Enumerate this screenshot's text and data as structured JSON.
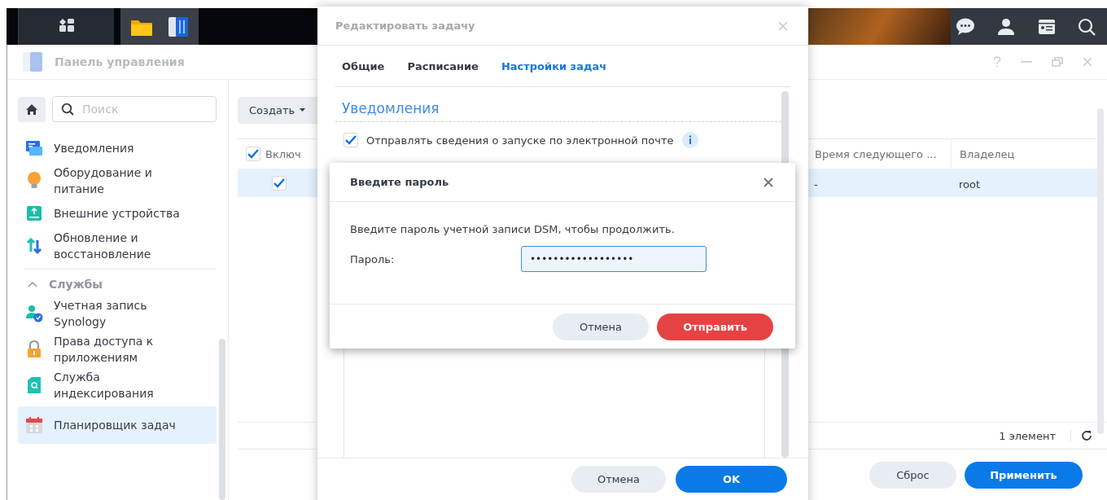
{
  "control_panel": {
    "title": "Панель управления",
    "search": {
      "placeholder": "Поиск"
    },
    "sidebar": {
      "items": [
        {
          "label": "Уведомления",
          "selected": false
        },
        {
          "label": "Оборудование и питание",
          "selected": false
        },
        {
          "label": "Внешние устройства",
          "selected": false
        },
        {
          "label": "Обновление и восстановление",
          "selected": false
        }
      ],
      "sections": [
        {
          "label": "Службы",
          "expanded": true,
          "items": [
            {
              "label": "Учетная запись Synology",
              "selected": false
            },
            {
              "label": "Права доступа к приложениям",
              "selected": false
            },
            {
              "label": "Служба индексирования",
              "selected": false
            },
            {
              "label": "Планировщик задач",
              "selected": true
            }
          ]
        }
      ]
    },
    "toolbar": {
      "create_button": "Создать"
    },
    "table": {
      "check_column": {
        "label": "Включ",
        "checked": true
      },
      "columns": [
        "Время следующего ...",
        "Владелец"
      ],
      "rows": [
        {
          "selected": true,
          "checked": true,
          "cells": [
            "-",
            "root"
          ]
        }
      ]
    },
    "footer": {
      "count": "1 элемент"
    },
    "buttons": [
      {
        "label": "Сброс",
        "kind": "secondary"
      },
      {
        "label": "Применить",
        "kind": "primary"
      }
    ]
  },
  "edit_task_dialog": {
    "title": "Редактировать задачу",
    "tabs": [
      {
        "label": "Общие",
        "selected": false
      },
      {
        "label": "Расписание",
        "selected": false
      },
      {
        "label": "Настройки задач",
        "selected": true
      }
    ],
    "section_title": "Уведомления",
    "options": [
      {
        "label": "Отправлять сведения о запуске по электронной почте",
        "checked": true
      }
    ],
    "buttons": [
      {
        "label": "Отмена",
        "kind": "secondary"
      },
      {
        "label": "OK",
        "kind": "primary"
      }
    ]
  },
  "password_dialog": {
    "title": "Введите пароль",
    "message": "Введите пароль учетной записи DSM, чтобы продолжить.",
    "field": {
      "label": "Пароль:",
      "value": "••••••••••••••••••"
    },
    "buttons": [
      {
        "label": "Отмена",
        "kind": "secondary"
      },
      {
        "label": "Отправить",
        "kind": "danger"
      }
    ]
  }
}
